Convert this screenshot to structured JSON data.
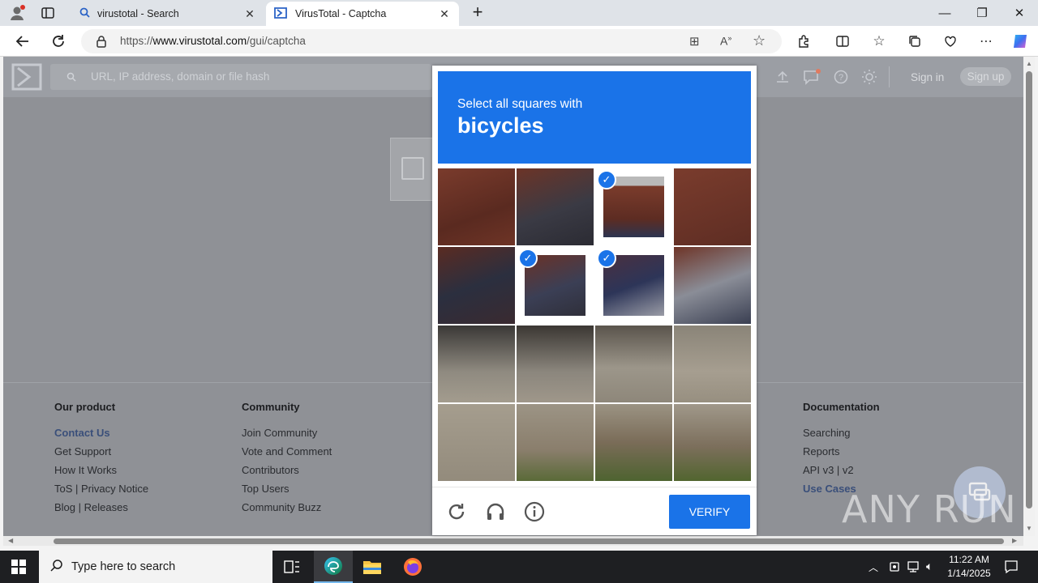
{
  "browser": {
    "tabs": [
      {
        "title": "virustotal - Search",
        "active": false
      },
      {
        "title": "VirusTotal - Captcha",
        "active": true
      }
    ],
    "url_prefix": "https://",
    "url_host": "www.virustotal.com",
    "url_path": "/gui/captcha"
  },
  "vt": {
    "search_placeholder": "URL, IP address, domain or file hash",
    "sign_in": "Sign in",
    "sign_up": "Sign up",
    "footer": {
      "col1": {
        "heading": "Our product",
        "links": [
          "Contact Us",
          "Get Support",
          "How It Works",
          "ToS | Privacy Notice",
          "Blog | Releases"
        ]
      },
      "col2": {
        "heading": "Community",
        "links": [
          "Join Community",
          "Vote and Comment",
          "Contributors",
          "Top Users",
          "Community Buzz"
        ]
      },
      "col5": {
        "heading": "Documentation",
        "links": [
          "Searching",
          "Reports",
          "API v3 | v2",
          "Use Cases"
        ]
      }
    }
  },
  "captcha": {
    "prompt": "Select all squares with",
    "object": "bicycles",
    "verify_label": "VERIFY",
    "selected_tiles": [
      2,
      5,
      6
    ]
  },
  "watermark": "ANY RUN",
  "taskbar": {
    "search_placeholder": "Type here to search",
    "time": "11:22 AM",
    "date": "1/14/2025"
  }
}
